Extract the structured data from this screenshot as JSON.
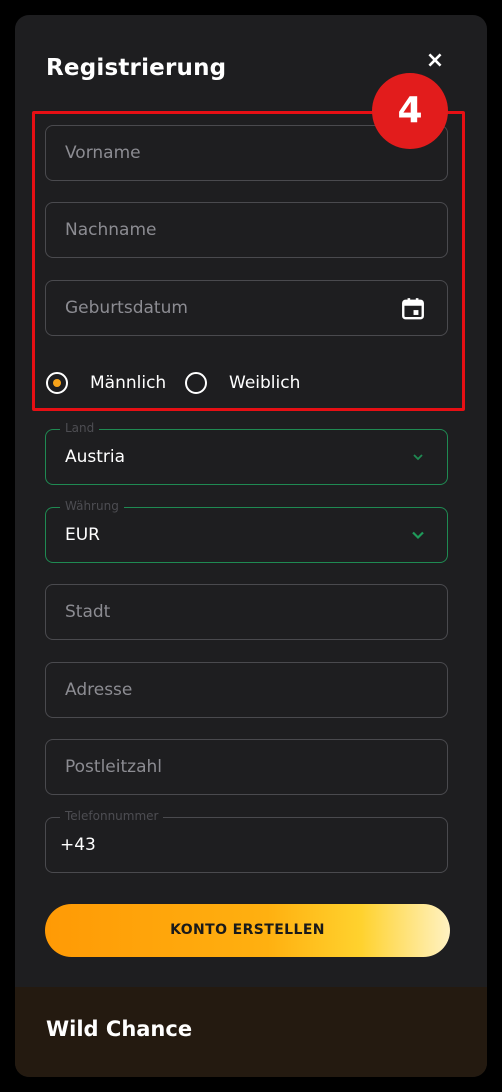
{
  "modal": {
    "title": "Registrierung",
    "close_label": "×"
  },
  "step_badge": "4",
  "form": {
    "first_name_placeholder": "Vorname",
    "last_name_placeholder": "Nachname",
    "birthdate_placeholder": "Geburtsdatum",
    "gender": {
      "options": [
        {
          "label": "Männlich",
          "selected": true
        },
        {
          "label": "Weiblich",
          "selected": false
        }
      ]
    },
    "country": {
      "label": "Land",
      "value": "Austria"
    },
    "currency": {
      "label": "Währung",
      "value": "EUR"
    },
    "city_placeholder": "Stadt",
    "address_placeholder": "Adresse",
    "zip_placeholder": "Postleitzahl",
    "phone": {
      "label": "Telefonnummer",
      "value": "+43"
    },
    "submit_label": "KONTO ERSTELLEN"
  },
  "footer": {
    "brand": "Wild Chance"
  },
  "colors": {
    "accent_orange": "#f7a31a",
    "highlight_red": "#e60f14",
    "valid_green": "#1f8a52",
    "modal_bg": "#1e1e20"
  },
  "icons": {
    "close": "close-icon",
    "calendar": "calendar-icon",
    "dropdown": "chevron-down-icon"
  }
}
